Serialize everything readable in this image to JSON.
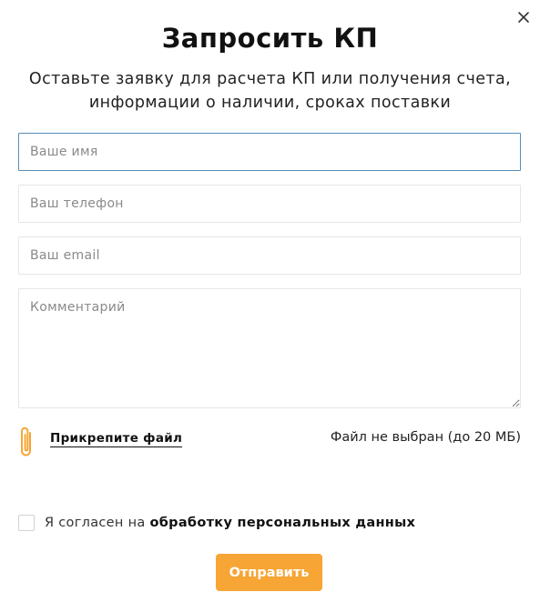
{
  "modal": {
    "title": "Запросить КП",
    "subtitle_line1": "Оставьте заявку для расчета КП или получения счета,",
    "subtitle_line2": "информации о наличии, сроках поставки"
  },
  "form": {
    "name_placeholder": "Ваше имя",
    "phone_placeholder": "Ваш телефон",
    "email_placeholder": "Ваш email",
    "comment_placeholder": "Комментарий",
    "attach_label": "Прикрепите файл",
    "file_status": "Файл не выбран (до 20 МБ)",
    "consent_prefix": "Я согласен на ",
    "consent_link": "обработку персональных данных",
    "consent_checked": false,
    "submit_label": "Отправить"
  },
  "icons": {
    "close": "close-icon",
    "attach": "paperclip-icon"
  },
  "colors": {
    "accent": "#f7a535",
    "focus_border": "#5b8db5",
    "field_border": "#e6e6e6"
  }
}
